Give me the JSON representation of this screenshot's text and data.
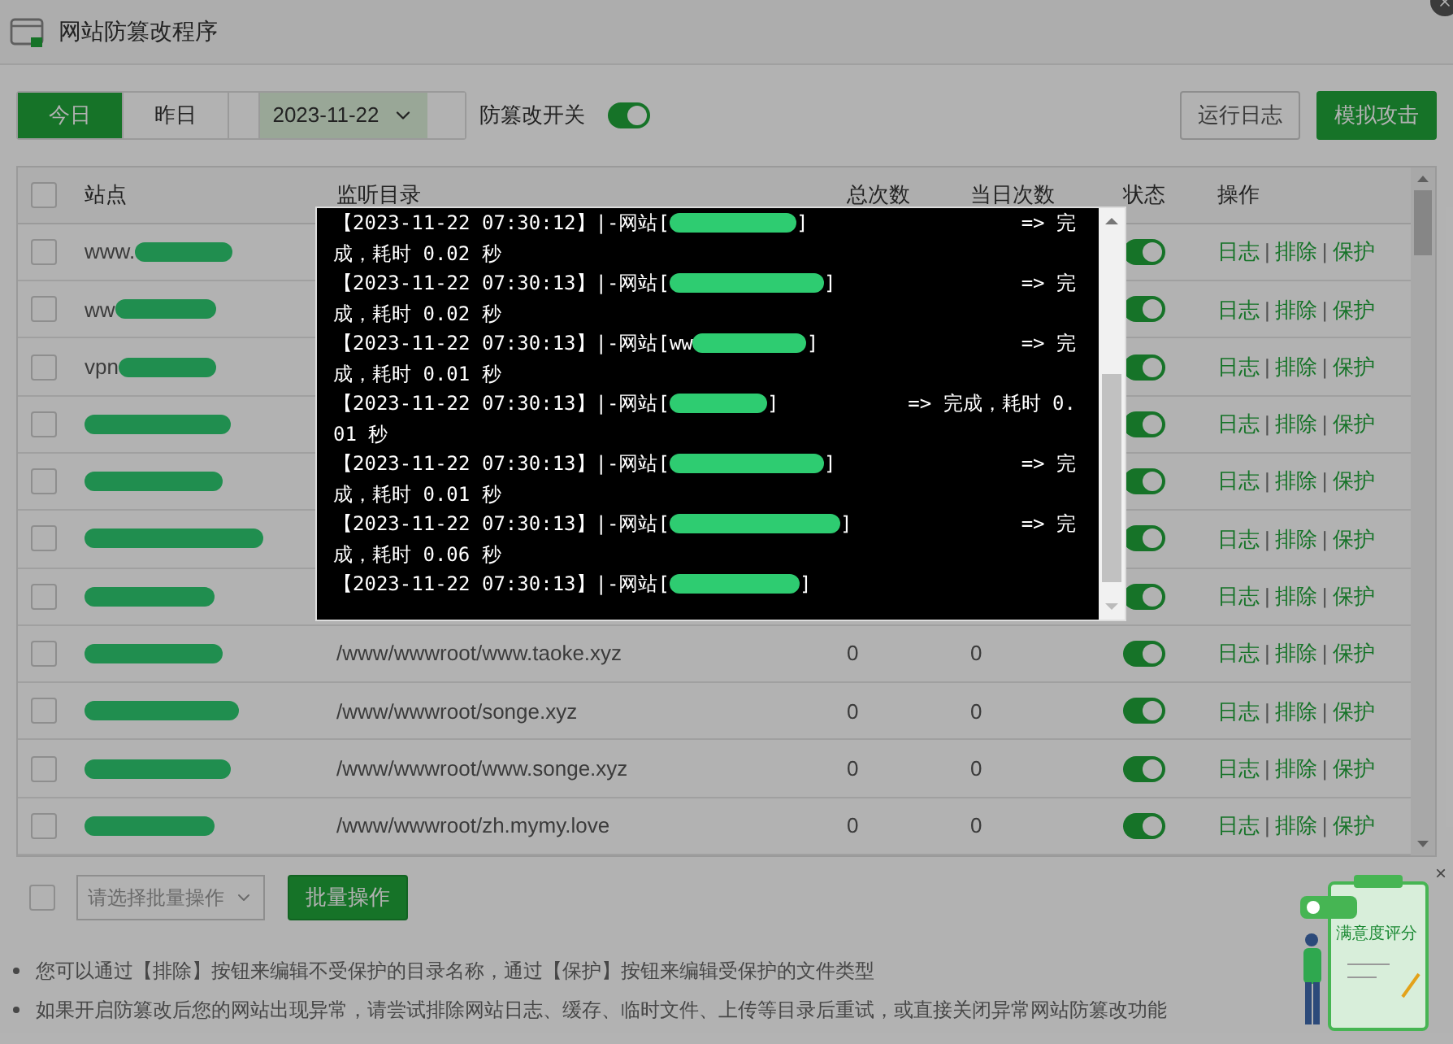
{
  "window": {
    "title": "网站防篡改程序"
  },
  "toolbar": {
    "tabs": [
      {
        "label": "今日",
        "selected": true
      },
      {
        "label": "昨日",
        "selected": false
      }
    ],
    "date": "2023-11-22",
    "switch_label": "防篡改开关",
    "switch_on": true,
    "buttons": [
      {
        "label": "运行日志",
        "kind": "outline"
      },
      {
        "label": "模拟攻击",
        "kind": "primary"
      }
    ]
  },
  "table": {
    "select_all_checked": false,
    "columns": [
      "站点",
      "监听目录",
      "总次数",
      "当日次数",
      "状态",
      "操作"
    ],
    "action_separator": "|",
    "rows": [
      {
        "checked": false,
        "site": "www.",
        "status_on": true,
        "actions": [
          "日志",
          "排除",
          "保护"
        ]
      },
      {
        "checked": false,
        "site": "ww",
        "status_on": true,
        "actions": [
          "日志",
          "排除",
          "保护"
        ]
      },
      {
        "checked": false,
        "site": "vpn",
        "status_on": true,
        "actions": [
          "日志",
          "排除",
          "保护"
        ]
      },
      {
        "checked": false,
        "status_on": true,
        "actions": [
          "日志",
          "排除",
          "保护"
        ]
      },
      {
        "checked": false,
        "status_on": true,
        "actions": [
          "日志",
          "排除",
          "保护"
        ]
      },
      {
        "checked": false,
        "status_on": true,
        "actions": [
          "日志",
          "排除",
          "保护"
        ]
      },
      {
        "checked": false,
        "status_on": true,
        "actions": [
          "日志",
          "排除",
          "保护"
        ]
      },
      {
        "checked": false,
        "directory": "/www/wwwroot/www.taoke.xyz",
        "total": "0",
        "today": "0",
        "status_on": true,
        "actions": [
          "日志",
          "排除",
          "保护"
        ]
      },
      {
        "checked": false,
        "directory": "/www/wwwroot/songe.xyz",
        "total": "0",
        "today": "0",
        "status_on": true,
        "actions": [
          "日志",
          "排除",
          "保护"
        ]
      },
      {
        "checked": false,
        "directory": "/www/wwwroot/www.songe.xyz",
        "total": "0",
        "today": "0",
        "status_on": true,
        "actions": [
          "日志",
          "排除",
          "保护"
        ]
      },
      {
        "checked": false,
        "directory": "/www/wwwroot/zh.mymy.love",
        "total": "0",
        "today": "0",
        "status_on": true,
        "actions": [
          "日志",
          "排除",
          "保护"
        ]
      }
    ]
  },
  "batch": {
    "checked": false,
    "select_placeholder": "请选择批量操作",
    "button": "批量操作"
  },
  "notes": [
    "您可以通过【排除】按钮来编辑不受保护的目录名称，通过【保护】按钮来编辑受保护的文件类型",
    "如果开启防篡改后您的网站出现异常，请尝试排除网站日志、缓存、临时文件、上传等目录后重试，或直接关闭异常网站防篡改功能"
  ],
  "log_popup": {
    "lines": [
      {
        "head": "【2023-11-22 07:30:12】|-网站[",
        "tail": "]",
        "result": "=> 完",
        "next": "成，耗时 0.02 秒"
      },
      {
        "head": "【2023-11-22 07:30:13】|-网站[",
        "tail": "]",
        "result": "=> 完",
        "next": "成，耗时 0.02 秒"
      },
      {
        "head": "【2023-11-22 07:30:13】|-网站[ww",
        "tail": "]",
        "result": "=> 完",
        "next": "成，耗时 0.01 秒"
      },
      {
        "head": "【2023-11-22 07:30:13】|-网站[",
        "tail": "]",
        "result": "=> 完成，耗时 0.",
        "next": "01 秒"
      },
      {
        "head": "【2023-11-22 07:30:13】|-网站[",
        "tail": "]",
        "result": "=> 完",
        "next": "成，耗时 0.01 秒"
      },
      {
        "head": "【2023-11-22 07:30:13】|-网站[",
        "tail": "]",
        "result": "=> 完",
        "next": "成，耗时 0.06 秒"
      },
      {
        "head": "【2023-11-22 07:30:13】|-网站[",
        "tail": "]"
      }
    ]
  },
  "rating_widget": {
    "label": "满意度评分",
    "close": "×"
  }
}
